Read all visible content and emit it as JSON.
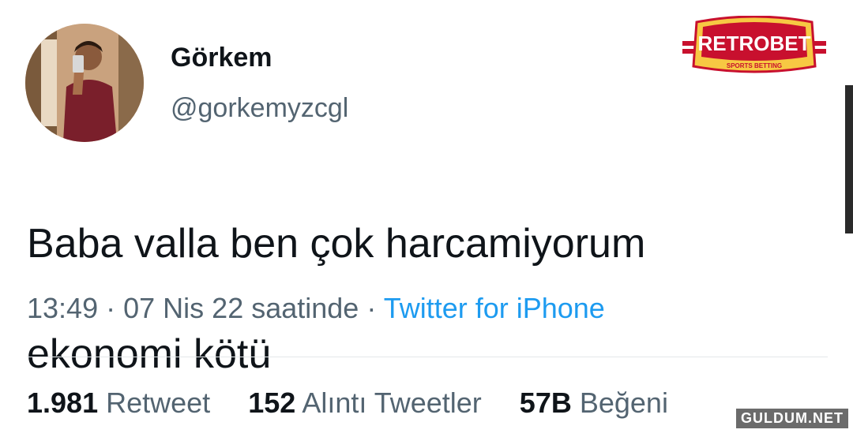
{
  "user": {
    "display_name": "Görkem",
    "handle": "@gorkemyzcgl"
  },
  "tweet": {
    "text_line1": "Baba valla ben çok harcamiyorum",
    "text_line2": "ekonomi kötü"
  },
  "meta": {
    "time": "13:49",
    "separator": "·",
    "date": "07 Nis 22 saatinde",
    "source": "Twitter for iPhone"
  },
  "stats": {
    "retweets_count": "1.981",
    "retweets_label": "Retweet",
    "quotes_count": "152",
    "quotes_label": "Alıntı Tweetler",
    "likes_count": "57B",
    "likes_label": "Beğeni"
  },
  "overlay": {
    "logo_text": "RETROBET",
    "logo_subtext": "SPORTS BETTING",
    "watermark": "GULDUM.NET"
  },
  "colors": {
    "primary_text": "#0f1419",
    "secondary_text": "#536471",
    "link_blue": "#1d9bf0",
    "logo_red": "#c8102e",
    "logo_yellow": "#f7c843"
  }
}
